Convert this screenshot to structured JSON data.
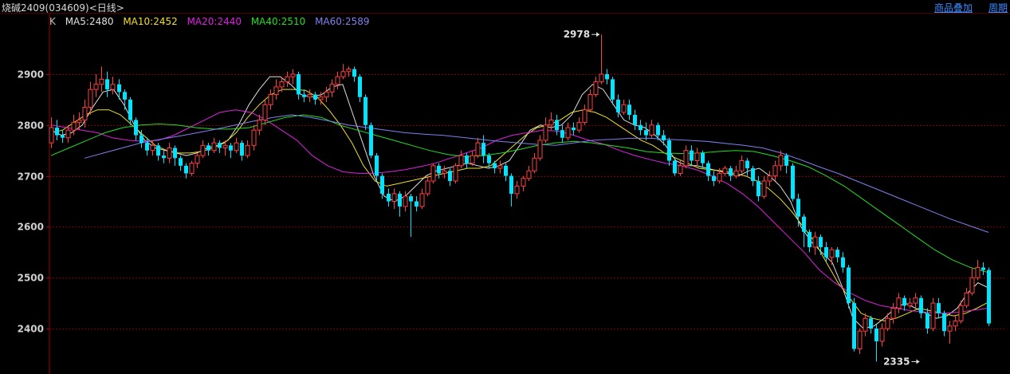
{
  "header": {
    "title": "烧碱2409(034609)<日线>",
    "buttons": [
      "商品叠加",
      "周期"
    ]
  },
  "legend": {
    "k_label": "K",
    "items": [
      {
        "text": "MA5:2480",
        "color": "#e0e0e0"
      },
      {
        "text": "MA10:2452",
        "color": "#f0e020"
      },
      {
        "text": "MA20:2440",
        "color": "#e020e0"
      },
      {
        "text": "MA40:2510",
        "color": "#20e020"
      },
      {
        "text": "MA60:2589",
        "color": "#8080f0"
      }
    ]
  },
  "chart_data": {
    "type": "candlestick",
    "ylim": [
      2325,
      3000
    ],
    "y_ticks": [
      2400,
      2500,
      2600,
      2700,
      2800,
      2900
    ],
    "grid": true,
    "colors": {
      "up": "#ff4040",
      "down": "#00e5ff",
      "grid": "#7a0000",
      "axis": "#a00000"
    },
    "annotations": [
      {
        "text": "2978",
        "value": 2978,
        "index": 98,
        "side": "left"
      },
      {
        "text": "2335",
        "value": 2335,
        "index": 155,
        "side": "left"
      }
    ],
    "candles": [
      [
        2765,
        2795,
        2815,
        2755
      ],
      [
        2795,
        2780,
        2810,
        2770
      ],
      [
        2780,
        2775,
        2790,
        2765
      ],
      [
        2775,
        2790,
        2800,
        2765
      ],
      [
        2790,
        2805,
        2820,
        2780
      ],
      [
        2805,
        2810,
        2825,
        2790
      ],
      [
        2810,
        2835,
        2850,
        2795
      ],
      [
        2835,
        2870,
        2885,
        2820
      ],
      [
        2870,
        2880,
        2900,
        2855
      ],
      [
        2880,
        2890,
        2915,
        2865
      ],
      [
        2890,
        2870,
        2905,
        2855
      ],
      [
        2870,
        2880,
        2895,
        2860
      ],
      [
        2880,
        2865,
        2890,
        2850
      ],
      [
        2865,
        2850,
        2870,
        2830
      ],
      [
        2850,
        2810,
        2855,
        2800
      ],
      [
        2810,
        2780,
        2815,
        2770
      ],
      [
        2780,
        2765,
        2790,
        2755
      ],
      [
        2765,
        2750,
        2775,
        2740
      ],
      [
        2750,
        2760,
        2770,
        2740
      ],
      [
        2760,
        2740,
        2765,
        2730
      ],
      [
        2740,
        2735,
        2750,
        2725
      ],
      [
        2735,
        2755,
        2765,
        2725
      ],
      [
        2755,
        2735,
        2760,
        2720
      ],
      [
        2735,
        2720,
        2740,
        2710
      ],
      [
        2720,
        2705,
        2725,
        2695
      ],
      [
        2705,
        2725,
        2730,
        2700
      ],
      [
        2725,
        2740,
        2745,
        2715
      ],
      [
        2740,
        2760,
        2770,
        2735
      ],
      [
        2760,
        2750,
        2765,
        2740
      ],
      [
        2750,
        2765,
        2775,
        2745
      ],
      [
        2765,
        2755,
        2770,
        2745
      ],
      [
        2755,
        2760,
        2770,
        2740
      ],
      [
        2760,
        2750,
        2765,
        2735
      ],
      [
        2750,
        2765,
        2775,
        2745
      ],
      [
        2765,
        2740,
        2770,
        2730
      ],
      [
        2740,
        2760,
        2770,
        2735
      ],
      [
        2760,
        2790,
        2800,
        2750
      ],
      [
        2790,
        2810,
        2820,
        2780
      ],
      [
        2810,
        2840,
        2850,
        2800
      ],
      [
        2840,
        2860,
        2870,
        2830
      ],
      [
        2860,
        2875,
        2890,
        2850
      ],
      [
        2875,
        2885,
        2895,
        2865
      ],
      [
        2885,
        2895,
        2905,
        2875
      ],
      [
        2895,
        2900,
        2910,
        2880
      ],
      [
        2900,
        2860,
        2905,
        2850
      ],
      [
        2860,
        2855,
        2870,
        2845
      ],
      [
        2855,
        2860,
        2870,
        2845
      ],
      [
        2860,
        2850,
        2865,
        2840
      ],
      [
        2850,
        2855,
        2865,
        2840
      ],
      [
        2855,
        2865,
        2875,
        2845
      ],
      [
        2865,
        2880,
        2890,
        2855
      ],
      [
        2880,
        2895,
        2905,
        2870
      ],
      [
        2895,
        2905,
        2920,
        2890
      ],
      [
        2905,
        2910,
        2915,
        2895
      ],
      [
        2910,
        2895,
        2915,
        2885
      ],
      [
        2895,
        2855,
        2900,
        2845
      ],
      [
        2855,
        2800,
        2860,
        2790
      ],
      [
        2800,
        2740,
        2805,
        2735
      ],
      [
        2740,
        2700,
        2745,
        2690
      ],
      [
        2700,
        2665,
        2705,
        2655
      ],
      [
        2665,
        2650,
        2675,
        2640
      ],
      [
        2650,
        2665,
        2675,
        2635
      ],
      [
        2665,
        2640,
        2670,
        2620
      ],
      [
        2640,
        2660,
        2670,
        2630
      ],
      [
        2660,
        2650,
        2665,
        2580
      ],
      [
        2650,
        2640,
        2660,
        2630
      ],
      [
        2640,
        2665,
        2675,
        2635
      ],
      [
        2665,
        2690,
        2700,
        2660
      ],
      [
        2690,
        2720,
        2725,
        2685
      ],
      [
        2720,
        2705,
        2725,
        2695
      ],
      [
        2705,
        2710,
        2720,
        2695
      ],
      [
        2710,
        2690,
        2715,
        2680
      ],
      [
        2690,
        2720,
        2725,
        2685
      ],
      [
        2720,
        2740,
        2750,
        2715
      ],
      [
        2740,
        2725,
        2745,
        2715
      ],
      [
        2725,
        2740,
        2750,
        2720
      ],
      [
        2740,
        2765,
        2775,
        2735
      ],
      [
        2765,
        2740,
        2780,
        2725
      ],
      [
        2740,
        2725,
        2745,
        2715
      ],
      [
        2725,
        2715,
        2730,
        2705
      ],
      [
        2715,
        2720,
        2730,
        2705
      ],
      [
        2720,
        2700,
        2725,
        2690
      ],
      [
        2700,
        2665,
        2705,
        2640
      ],
      [
        2665,
        2680,
        2690,
        2655
      ],
      [
        2680,
        2695,
        2700,
        2670
      ],
      [
        2695,
        2710,
        2720,
        2690
      ],
      [
        2710,
        2735,
        2745,
        2705
      ],
      [
        2735,
        2770,
        2780,
        2730
      ],
      [
        2770,
        2800,
        2815,
        2765
      ],
      [
        2800,
        2810,
        2825,
        2790
      ],
      [
        2810,
        2790,
        2820,
        2780
      ],
      [
        2790,
        2775,
        2800,
        2765
      ],
      [
        2775,
        2795,
        2805,
        2770
      ],
      [
        2795,
        2790,
        2805,
        2780
      ],
      [
        2790,
        2805,
        2815,
        2785
      ],
      [
        2805,
        2830,
        2840,
        2800
      ],
      [
        2830,
        2860,
        2870,
        2825
      ],
      [
        2860,
        2885,
        2895,
        2855
      ],
      [
        2885,
        2900,
        2978,
        2880
      ],
      [
        2900,
        2890,
        2910,
        2880
      ],
      [
        2890,
        2850,
        2895,
        2840
      ],
      [
        2850,
        2825,
        2860,
        2815
      ],
      [
        2825,
        2840,
        2850,
        2820
      ],
      [
        2840,
        2820,
        2850,
        2810
      ],
      [
        2820,
        2800,
        2830,
        2790
      ],
      [
        2800,
        2790,
        2810,
        2780
      ],
      [
        2790,
        2780,
        2805,
        2770
      ],
      [
        2780,
        2800,
        2810,
        2775
      ],
      [
        2800,
        2780,
        2805,
        2770
      ],
      [
        2780,
        2770,
        2790,
        2760
      ],
      [
        2770,
        2730,
        2775,
        2720
      ],
      [
        2730,
        2705,
        2735,
        2700
      ],
      [
        2705,
        2720,
        2730,
        2700
      ],
      [
        2720,
        2750,
        2760,
        2715
      ],
      [
        2750,
        2730,
        2760,
        2720
      ],
      [
        2730,
        2745,
        2755,
        2720
      ],
      [
        2745,
        2725,
        2750,
        2715
      ],
      [
        2725,
        2700,
        2730,
        2690
      ],
      [
        2700,
        2690,
        2710,
        2680
      ],
      [
        2690,
        2705,
        2715,
        2685
      ],
      [
        2705,
        2715,
        2720,
        2700
      ],
      [
        2715,
        2700,
        2720,
        2690
      ],
      [
        2700,
        2710,
        2720,
        2695
      ],
      [
        2710,
        2730,
        2740,
        2705
      ],
      [
        2730,
        2715,
        2735,
        2700
      ],
      [
        2715,
        2690,
        2720,
        2680
      ],
      [
        2690,
        2660,
        2700,
        2650
      ],
      [
        2660,
        2690,
        2700,
        2655
      ],
      [
        2690,
        2700,
        2710,
        2680
      ],
      [
        2700,
        2720,
        2730,
        2690
      ],
      [
        2720,
        2740,
        2750,
        2710
      ],
      [
        2740,
        2720,
        2745,
        2705
      ],
      [
        2720,
        2655,
        2725,
        2650
      ],
      [
        2655,
        2620,
        2665,
        2600
      ],
      [
        2620,
        2590,
        2625,
        2560
      ],
      [
        2590,
        2560,
        2595,
        2550
      ],
      [
        2560,
        2580,
        2590,
        2545
      ],
      [
        2580,
        2560,
        2585,
        2545
      ],
      [
        2560,
        2540,
        2570,
        2530
      ],
      [
        2540,
        2555,
        2560,
        2525
      ],
      [
        2555,
        2540,
        2560,
        2530
      ],
      [
        2540,
        2520,
        2550,
        2510
      ],
      [
        2520,
        2450,
        2525,
        2440
      ],
      [
        2450,
        2360,
        2460,
        2355
      ],
      [
        2360,
        2395,
        2400,
        2350
      ],
      [
        2395,
        2420,
        2430,
        2385
      ],
      [
        2420,
        2400,
        2425,
        2390
      ],
      [
        2400,
        2375,
        2410,
        2335
      ],
      [
        2375,
        2400,
        2410,
        2365
      ],
      [
        2400,
        2420,
        2430,
        2395
      ],
      [
        2420,
        2440,
        2450,
        2410
      ],
      [
        2440,
        2460,
        2470,
        2430
      ],
      [
        2460,
        2445,
        2465,
        2435
      ],
      [
        2445,
        2450,
        2460,
        2440
      ],
      [
        2450,
        2460,
        2470,
        2440
      ],
      [
        2460,
        2430,
        2465,
        2420
      ],
      [
        2430,
        2400,
        2440,
        2390
      ],
      [
        2400,
        2450,
        2460,
        2395
      ],
      [
        2450,
        2430,
        2460,
        2420
      ],
      [
        2430,
        2395,
        2435,
        2385
      ],
      [
        2395,
        2405,
        2415,
        2370
      ],
      [
        2405,
        2415,
        2425,
        2395
      ],
      [
        2415,
        2445,
        2455,
        2410
      ],
      [
        2445,
        2470,
        2480,
        2440
      ],
      [
        2470,
        2500,
        2520,
        2465
      ],
      [
        2500,
        2520,
        2535,
        2495
      ],
      [
        2520,
        2515,
        2530,
        2505
      ],
      [
        2515,
        2410,
        2520,
        2405
      ]
    ],
    "ma": [
      {
        "name": "MA5",
        "color": "#e0e0e0",
        "start": 0,
        "values": [
          2790,
          2780,
          2785,
          2800,
          2835,
          2865,
          2870,
          2840,
          2800,
          2770,
          2755,
          2750,
          2745,
          2740,
          2745,
          2755,
          2760,
          2770,
          2800,
          2840,
          2870,
          2895,
          2895,
          2880,
          2860,
          2855,
          2860,
          2875,
          2880,
          2820,
          2760,
          2700,
          2660,
          2650,
          2660,
          2680,
          2700,
          2710,
          2715,
          2720,
          2725,
          2720,
          2715,
          2720,
          2730,
          2760,
          2790,
          2800,
          2795,
          2800,
          2820,
          2860,
          2880,
          2870,
          2840,
          2810,
          2800,
          2795,
          2780,
          2760,
          2730,
          2720,
          2720,
          2715,
          2710,
          2705,
          2700,
          2710,
          2715,
          2700,
          2680,
          2650,
          2600,
          2570,
          2550,
          2530,
          2480,
          2420,
          2400,
          2405,
          2420,
          2440,
          2450,
          2440,
          2430,
          2420,
          2425,
          2440,
          2470,
          2490,
          2480
        ]
      },
      {
        "name": "MA10",
        "color": "#f0e020",
        "start": 0,
        "values": [
          2785,
          2790,
          2805,
          2820,
          2830,
          2830,
          2820,
          2800,
          2780,
          2760,
          2750,
          2745,
          2745,
          2748,
          2755,
          2765,
          2785,
          2815,
          2840,
          2860,
          2870,
          2870,
          2868,
          2855,
          2830,
          2800,
          2765,
          2720,
          2690,
          2680,
          2685,
          2690,
          2695,
          2700,
          2705,
          2710,
          2715,
          2715,
          2720,
          2740,
          2760,
          2780,
          2795,
          2800,
          2810,
          2825,
          2830,
          2825,
          2815,
          2800,
          2785,
          2770,
          2760,
          2745,
          2735,
          2725,
          2715,
          2712,
          2710,
          2705,
          2700,
          2690,
          2675,
          2655,
          2630,
          2600,
          2570,
          2530,
          2490,
          2460,
          2430,
          2420,
          2415,
          2420,
          2430,
          2440,
          2435,
          2430,
          2425,
          2430,
          2440,
          2452
        ]
      },
      {
        "name": "MA20",
        "color": "#e020e0",
        "start": 0,
        "values": [
          2800,
          2795,
          2790,
          2785,
          2775,
          2770,
          2768,
          2770,
          2780,
          2795,
          2810,
          2825,
          2830,
          2825,
          2810,
          2790,
          2770,
          2740,
          2720,
          2708,
          2705,
          2705,
          2708,
          2712,
          2718,
          2725,
          2735,
          2745,
          2755,
          2770,
          2780,
          2785,
          2790,
          2788,
          2780,
          2770,
          2762,
          2750,
          2740,
          2732,
          2725,
          2720,
          2712,
          2700,
          2685,
          2665,
          2640,
          2610,
          2580,
          2550,
          2515,
          2490,
          2470,
          2455,
          2445,
          2440,
          2435,
          2432,
          2430,
          2432,
          2436,
          2440
        ]
      },
      {
        "name": "MA40",
        "color": "#20e020",
        "start": 0,
        "values": [
          2740,
          2755,
          2770,
          2785,
          2795,
          2800,
          2802,
          2800,
          2795,
          2792,
          2792,
          2795,
          2805,
          2815,
          2820,
          2815,
          2800,
          2790,
          2780,
          2770,
          2760,
          2750,
          2742,
          2738,
          2740,
          2745,
          2752,
          2760,
          2765,
          2768,
          2765,
          2760,
          2755,
          2748,
          2745,
          2744,
          2745,
          2748,
          2750,
          2748,
          2740,
          2730,
          2718,
          2700,
          2680,
          2655,
          2630,
          2605,
          2580,
          2555,
          2535,
          2520,
          2510
        ]
      },
      {
        "name": "MA60",
        "color": "#8080f0",
        "start": 6,
        "values": [
          2735,
          2745,
          2755,
          2765,
          2772,
          2778,
          2785,
          2792,
          2800,
          2808,
          2815,
          2820,
          2815,
          2808,
          2800,
          2795,
          2790,
          2785,
          2782,
          2780,
          2776,
          2772,
          2768,
          2765,
          2762,
          2760,
          2765,
          2770,
          2772,
          2774,
          2774,
          2772,
          2770,
          2768,
          2764,
          2760,
          2755,
          2745,
          2732,
          2718,
          2705,
          2690,
          2675,
          2660,
          2645,
          2630,
          2615,
          2602,
          2589
        ]
      }
    ]
  }
}
